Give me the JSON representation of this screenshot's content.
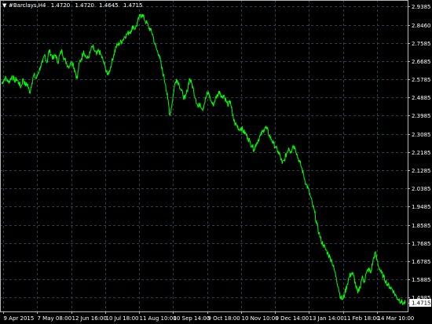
{
  "header": {
    "symbol": "#Barclays,H4",
    "open": "1.4720",
    "high": "1.4720",
    "low": "1.4645",
    "close": "1.4715"
  },
  "colors": {
    "background": "#000000",
    "grid": "#2e3f4a",
    "frame": "#b8b8b8",
    "series": "#00ff00",
    "text": "#ffffff",
    "price_label_bg": "#ffffff",
    "price_label_text": "#000000"
  },
  "chart_data": {
    "type": "line",
    "title": "",
    "xlabel": "",
    "ylabel": "",
    "grid": true,
    "ylim": [
      1.43,
      2.97
    ],
    "y_ticks": [
      "2.9385",
      "2.8460",
      "2.7585",
      "2.6685",
      "2.5785",
      "2.4885",
      "2.3985",
      "2.3085",
      "2.2185",
      "2.1285",
      "2.0385",
      "1.9485",
      "1.8585",
      "1.7685",
      "1.6785",
      "1.5885",
      "1.4985"
    ],
    "x_ticks": [
      "9 Apr 2015",
      "7 May 08:00",
      "12 Jun 16:00",
      "10 Jul 18:00",
      "11 Aug 10:00",
      "10 Sep 14:00",
      "9 Oct 18:00",
      "10 Nov 10:00",
      "9 Dec 14:00",
      "13 Jan 14:00",
      "11 Feb 18:00",
      "14 Mar 10:00"
    ],
    "last_price": "1.4715",
    "series": [
      {
        "values": [
          2.555,
          2.575,
          2.585,
          2.565,
          2.575,
          2.595,
          2.57,
          2.58,
          2.56,
          2.54,
          2.58,
          2.55,
          2.555,
          2.51,
          2.56,
          2.6,
          2.58,
          2.61,
          2.64,
          2.66,
          2.7,
          2.66,
          2.72,
          2.7,
          2.68,
          2.7,
          2.66,
          2.7,
          2.72,
          2.68,
          2.66,
          2.64,
          2.66,
          2.66,
          2.62,
          2.58,
          2.66,
          2.68,
          2.72,
          2.69,
          2.68,
          2.71,
          2.74,
          2.72,
          2.7,
          2.72,
          2.7,
          2.67,
          2.64,
          2.6,
          2.62,
          2.66,
          2.7,
          2.74,
          2.75,
          2.76,
          2.77,
          2.79,
          2.8,
          2.81,
          2.82,
          2.84,
          2.83,
          2.86,
          2.89,
          2.9,
          2.88,
          2.86,
          2.84,
          2.82,
          2.8,
          2.75,
          2.72,
          2.7,
          2.64,
          2.6,
          2.55,
          2.48,
          2.4,
          2.46,
          2.54,
          2.58,
          2.56,
          2.53,
          2.5,
          2.48,
          2.52,
          2.58,
          2.56,
          2.52,
          2.48,
          2.44,
          2.46,
          2.43,
          2.46,
          2.5,
          2.51,
          2.47,
          2.45,
          2.48,
          2.5,
          2.52,
          2.49,
          2.5,
          2.47,
          2.45,
          2.47,
          2.4,
          2.36,
          2.35,
          2.33,
          2.34,
          2.32,
          2.31,
          2.29,
          2.27,
          2.25,
          2.23,
          2.26,
          2.28,
          2.3,
          2.32,
          2.34,
          2.33,
          2.3,
          2.28,
          2.26,
          2.24,
          2.22,
          2.2,
          2.16,
          2.18,
          2.21,
          2.24,
          2.22,
          2.25,
          2.24,
          2.2,
          2.17,
          2.14,
          2.1,
          2.06,
          2.04,
          2.0,
          1.96,
          1.92,
          1.86,
          1.82,
          1.78,
          1.76,
          1.74,
          1.72,
          1.7,
          1.68,
          1.64,
          1.6,
          1.55,
          1.5,
          1.49,
          1.52,
          1.56,
          1.6,
          1.62,
          1.61,
          1.56,
          1.52,
          1.55,
          1.6,
          1.58,
          1.62,
          1.64,
          1.62,
          1.68,
          1.72,
          1.68,
          1.64,
          1.62,
          1.6,
          1.58,
          1.56,
          1.55,
          1.54,
          1.52,
          1.5,
          1.49,
          1.48,
          1.47,
          1.4715
        ]
      }
    ]
  }
}
